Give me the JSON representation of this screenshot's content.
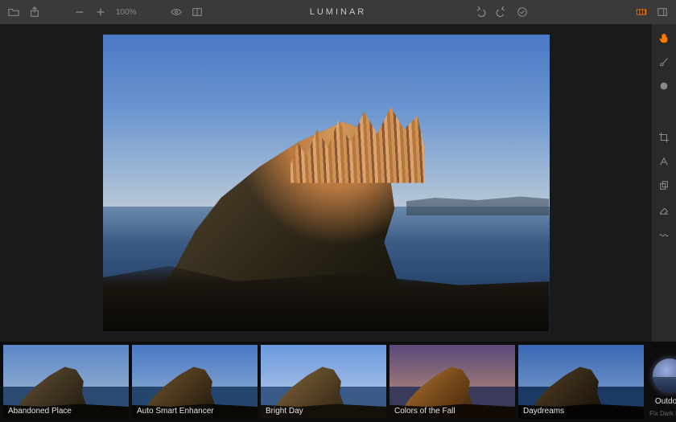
{
  "app_title": "LUMINAR",
  "zoom": {
    "level": "100%"
  },
  "toolbar_icons": {
    "open": "open-folder-icon",
    "share": "share-icon",
    "zoom_out": "minus-icon",
    "zoom_in": "plus-icon",
    "preview": "eye-icon",
    "compare": "compare-split-icon",
    "undo": "undo-icon",
    "redo": "redo-icon",
    "apply": "checkmark-circle-icon",
    "presets_panel": "filmstrip-icon",
    "side_panel": "side-panel-icon"
  },
  "right_tools": [
    {
      "name": "hand-tool-icon",
      "active": true
    },
    {
      "name": "brush-tool-icon",
      "active": false
    },
    {
      "name": "radial-mask-icon",
      "active": false
    },
    {
      "name": "crop-tool-icon",
      "active": false
    },
    {
      "name": "transform-tool-icon",
      "active": false
    },
    {
      "name": "clone-tool-icon",
      "active": false
    },
    {
      "name": "erase-tool-icon",
      "active": false
    },
    {
      "name": "denoise-tool-icon",
      "active": false
    }
  ],
  "presets": [
    {
      "label": "Abandoned Place",
      "selected": true
    },
    {
      "label": "Auto Smart Enhancer",
      "selected": false
    },
    {
      "label": "Bright Day",
      "selected": false
    },
    {
      "label": "Colors of the Fall",
      "selected": false
    },
    {
      "label": "Daydreams",
      "selected": false
    }
  ],
  "preset_category": {
    "label": "Outdoor",
    "sub": "Fix Dark Land"
  }
}
